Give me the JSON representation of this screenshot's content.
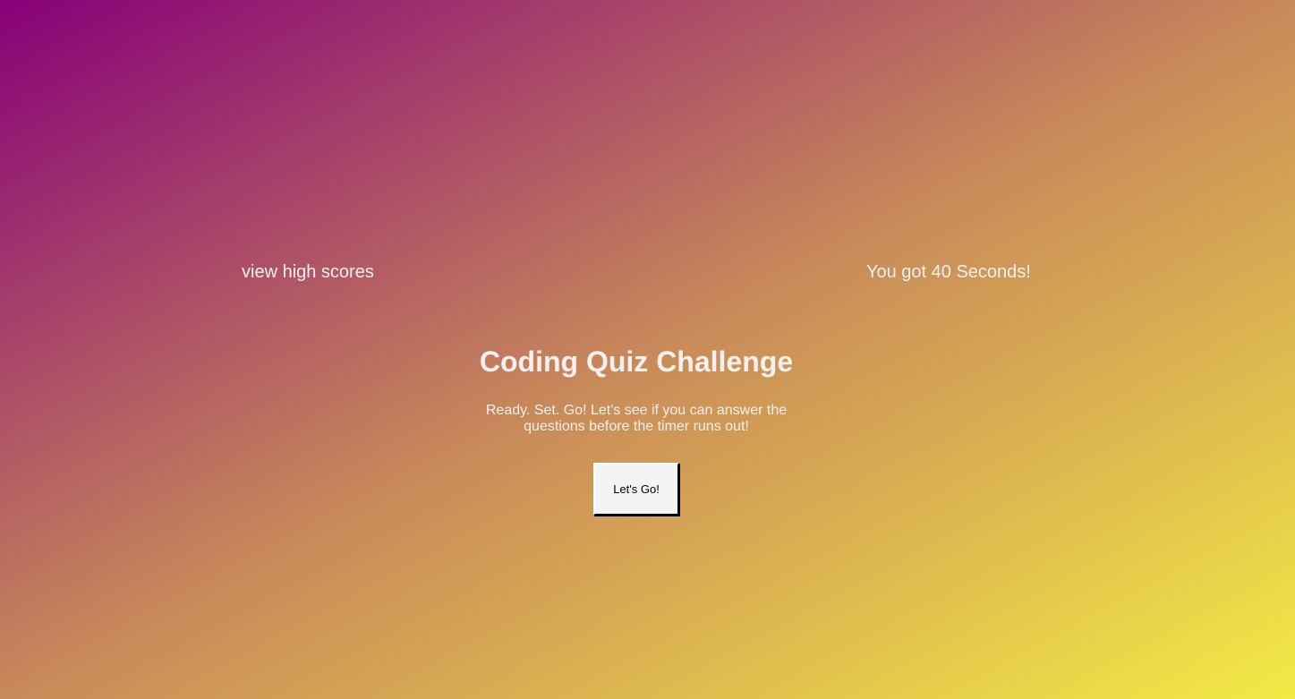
{
  "header": {
    "high_scores_label": "view high scores",
    "timer_text": "You got 40 Seconds!"
  },
  "main": {
    "title": "Coding Quiz Challenge",
    "intro": "Ready. Set. Go! Let's see if you can answer the questions before the timer runs out!",
    "start_button_label": "Let's Go!"
  },
  "colors": {
    "gradient_start": "#870079",
    "gradient_mid": "#c8895a",
    "gradient_end": "#f3ea45",
    "text": "#f3f0ef",
    "button_bg": "#f4f4f4"
  }
}
